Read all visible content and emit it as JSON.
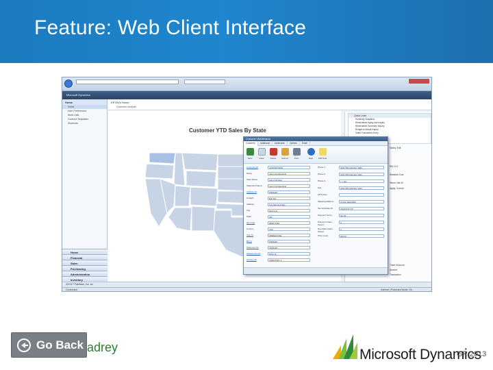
{
  "slide": {
    "title": "Feature: Web Client Interface",
    "go_back_label": "Go Back",
    "partner_text": "adrey",
    "ms_brand": "Microsoft Dynamics",
    "ms_product": "GP 2013"
  },
  "screenshot": {
    "chart_title": "Customer YTD Sales By State",
    "nav_pane": {
      "title": "Home",
      "items": [
        "Home",
        "User Preferences",
        "Work Lists",
        "Connect Templates",
        "Shortcuts"
      ],
      "buttons": [
        "Home",
        "Financial",
        "Sales",
        "Purchasing",
        "Administration",
        "Inventory"
      ]
    },
    "home_header": {
      "label": "KEVIN's Home",
      "sub": "Customer Analysis"
    },
    "quick_links": {
      "header": "Quick Links",
      "items": [
        "Summary Snapshot",
        "Receivables Aging and Inquiry",
        "Receivables Summary Inquiry",
        "Budget to Actual Inquiry",
        "Sales Transaction Entry"
      ]
    },
    "customer_window": {
      "title": "Customer Maintenance",
      "tabs": [
        "Customer",
        "Additional",
        "Addresses",
        "Options",
        "Email"
      ],
      "ribbon_buttons": [
        "Save",
        "Clear",
        "Delete",
        "Actions",
        "Print",
        "Help",
        "Add Note"
      ],
      "fields": [
        {
          "label": "Customer ID",
          "value": "AARONFIT0001",
          "link": true
        },
        {
          "label": "Name",
          "value": "Aaron Fitz Electrical",
          "link": false
        },
        {
          "label": "Short Name",
          "value": "Aaron Fitz Elec",
          "link": false
        },
        {
          "label": "Statement Name",
          "value": "Aaron Fitz Electrical",
          "link": false
        },
        {
          "label": "Address ID",
          "value": "PRIMARY",
          "link": true
        },
        {
          "label": "Contact",
          "value": "Bob Fitz",
          "link": false
        },
        {
          "label": "Address",
          "value": "One Microsoft Way",
          "link": false
        },
        {
          "label": "City",
          "value": "Redmond",
          "link": false
        },
        {
          "label": "State",
          "value": "WA",
          "link": false
        },
        {
          "label": "Zip Code",
          "value": "98052-6399",
          "link": true
        },
        {
          "label": "Country",
          "value": "USA",
          "link": false
        },
        {
          "label": "Ship To",
          "value": "WAREHOUSE",
          "link": true
        },
        {
          "label": "Bill To",
          "value": "PRIMARY",
          "link": true
        },
        {
          "label": "Statement To",
          "value": "PRIMARY",
          "link": true
        },
        {
          "label": "Salesperson ID",
          "value": "PAUL W.",
          "link": true
        },
        {
          "label": "Territory ID",
          "value": "TERRITORY 2",
          "link": true
        }
      ],
      "right_fields": [
        {
          "label": "Phone 1",
          "value": "(425) 555-0123 Ext. 0000"
        },
        {
          "label": "Phone 2",
          "value": "(425) 555-0124 Ext. 0000"
        },
        {
          "label": "Phone 3",
          "value": "(  )   -     Ext."
        },
        {
          "label": "Fax",
          "value": "(425) 555-0125 Ext. 0000"
        },
        {
          "label": "UPS Zone",
          "value": ""
        },
        {
          "label": "Shipping Method",
          "value": "LOCAL DELIVERY"
        },
        {
          "label": "Tax Schedule ID",
          "value": "USASTCITY-6*"
        },
        {
          "label": "Payment Terms",
          "value": "Net 30"
        },
        {
          "label": "Discount Grace Period",
          "value": "0"
        },
        {
          "label": "Due Date Grace Period",
          "value": "0"
        },
        {
          "label": "Price Level",
          "value": "RETAIL"
        }
      ]
    },
    "side_lines": [
      "Status: Edit",
      "RM 10.0",
      "Standard Cust",
      "Terms: Net 30",
      "Aging: Current",
      "Trade Discount",
      "Amount",
      "Transaction"
    ],
    "status_bar": "4/12/17  Fabrikam, Inc.  sa",
    "ie_status": "Connected",
    "ie_zone": "Internet | Protected Mode: On",
    "map_colors": {
      "very_dark": "#1616c8",
      "dark": "#3a3ad8",
      "medium": "#5b7ad8",
      "light": "#a9bfe6",
      "very_light": "#d7e1f1",
      "base": "#c7d4e6"
    }
  }
}
